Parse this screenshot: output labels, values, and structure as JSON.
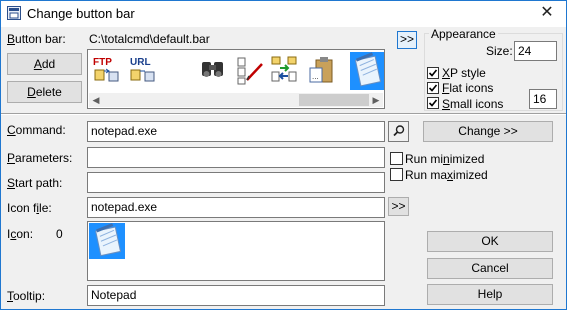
{
  "window": {
    "title": "Change button bar",
    "close_glyph": "✕"
  },
  "button_bar": {
    "label": "Button bar:",
    "path": "C:\\totalcmd\\default.bar",
    "browse_label": ">>",
    "add_label": "Add",
    "delete_label": "Delete",
    "icons": [
      "ftp-connect-icon",
      "url-connect-icon",
      "binoculars-search-icon",
      "multi-rename-icon",
      "copy-files-icon",
      "paste-clipboard-icon",
      "notepad-icon"
    ],
    "scroll_left": "◀",
    "scroll_right": "▶"
  },
  "appearance": {
    "legend": "Appearance",
    "size_label": "Size:",
    "size_value": "24",
    "xp_style_label": "XP style",
    "xp_style_checked": true,
    "flat_icons_label": "Flat icons",
    "flat_icons_checked": true,
    "small_icons_label": "Small icons",
    "small_icons_checked": true,
    "small_icons_size": "16"
  },
  "command": {
    "label": "Command:",
    "value": "notepad.exe",
    "change_label": "Change >>"
  },
  "parameters": {
    "label": "Parameters:",
    "value": ""
  },
  "start_path": {
    "label": "Start path:",
    "value": ""
  },
  "run_minimized": {
    "label": "Run minimized",
    "checked": false
  },
  "run_maximized": {
    "label": "Run maximized",
    "checked": false
  },
  "icon_file": {
    "label": "Icon file:",
    "value": "notepad.exe",
    "browse_label": ">>"
  },
  "icon": {
    "label": "Icon:",
    "index": "0"
  },
  "tooltip": {
    "label": "Tooltip:",
    "value": "Notepad"
  },
  "buttons": {
    "ok": "OK",
    "cancel": "Cancel",
    "help": "Help"
  },
  "colors": {
    "accent": "#1f77d0",
    "selected_icon_bg": "#1e90ff"
  }
}
